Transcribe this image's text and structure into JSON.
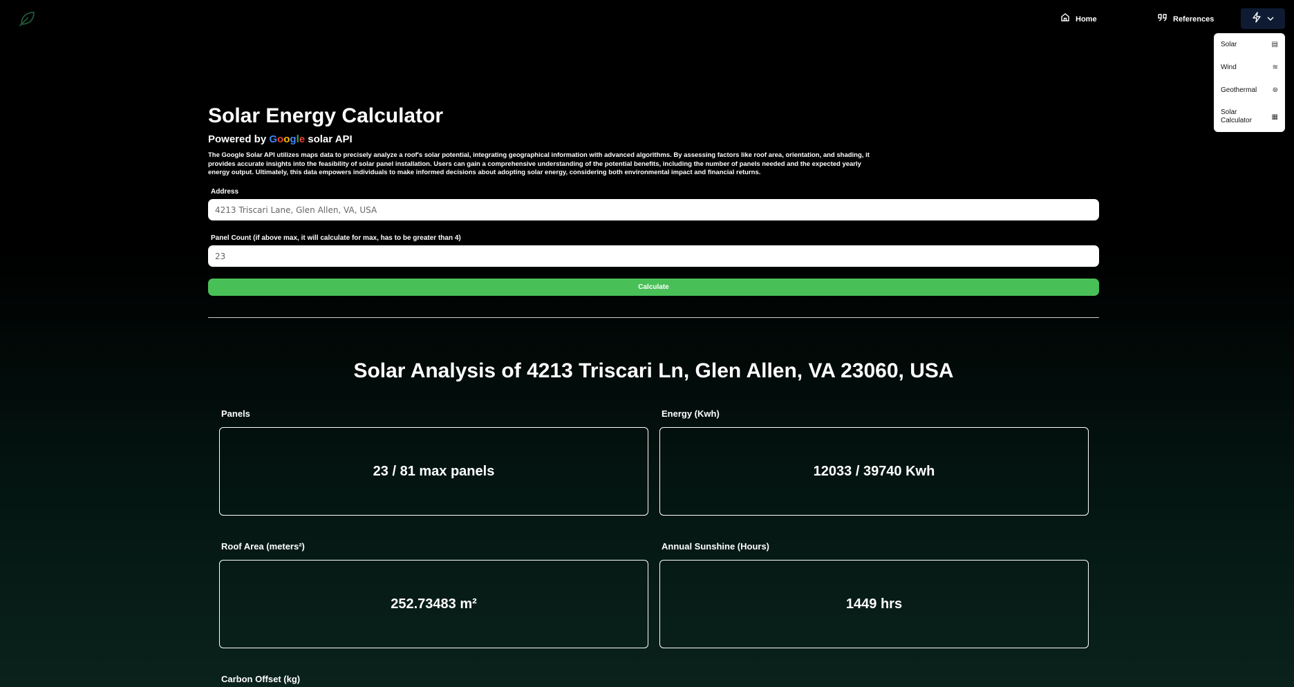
{
  "header": {
    "nav": {
      "home": "Home",
      "references": "References"
    },
    "dropdown": [
      {
        "label": "Solar",
        "icon": "solar-panel-icon"
      },
      {
        "label": "Wind",
        "icon": "wind-icon"
      },
      {
        "label": "Geothermal",
        "icon": "geothermal-icon"
      },
      {
        "label": "Solar Calculator",
        "icon": "calculator-icon"
      }
    ]
  },
  "calculator": {
    "title": "Solar Energy Calculator",
    "powered_prefix": "Powered by",
    "powered_suffix": "solar API",
    "description": "The Google Solar API utilizes maps data to precisely analyze a roof's solar potential, integrating geographical information with advanced algorithms. By assessing factors like roof area, orientation, and shading, it provides accurate insights into the feasibility of solar panel installation. Users can gain a comprehensive understanding of the potential benefits, including the number of panels needed and the expected yearly energy output. Ultimately, this data empowers individuals to make informed decisions about adopting solar energy, considering both environmental impact and financial returns.",
    "address_label": "Address",
    "address_value": "4213 Triscari Lane, Glen Allen, VA, USA",
    "panel_label": "Panel Count (if above max, it will calculate for max, has to be greater than 4)",
    "panel_value": "23",
    "calculate_label": "Calculate"
  },
  "analysis": {
    "title": "Solar Analysis of 4213 Triscari Ln, Glen Allen, VA 23060, USA",
    "stats": [
      {
        "label": "Panels",
        "value": "23 / 81 max panels"
      },
      {
        "label": "Energy (Kwh)",
        "value": "12033 / 39740 Kwh"
      },
      {
        "label": "Roof Area (meters²)",
        "value": "252.73483 m²"
      },
      {
        "label": "Annual Sunshine (Hours)",
        "value": "1449 hrs"
      },
      {
        "label": "Carbon Offset (kg)"
      }
    ]
  },
  "colors": {
    "accent": "#49c057",
    "nav_toggle_bg": "#0e1b33"
  }
}
